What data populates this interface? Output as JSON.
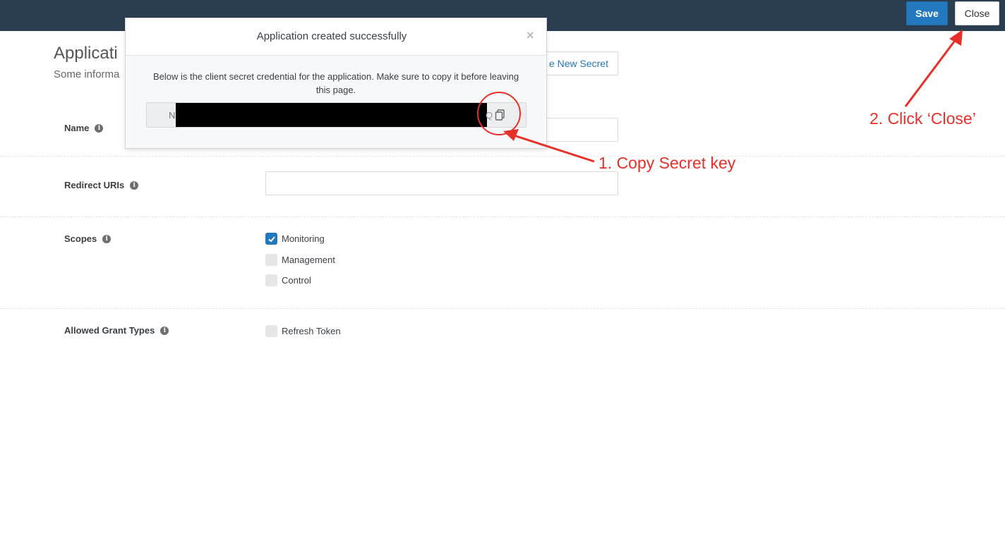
{
  "header": {
    "save_label": "Save",
    "close_label": "Close"
  },
  "page": {
    "title": "Applicati",
    "subtitle": "Some informa",
    "new_secret_label": "e New Secret"
  },
  "form": {
    "name_label": "Name",
    "redirect_label": "Redirect URIs",
    "scopes_label": "Scopes",
    "grant_label": "Allowed Grant Types",
    "scopes": [
      {
        "label": "Monitoring",
        "checked": true
      },
      {
        "label": "Management",
        "checked": false
      },
      {
        "label": "Control",
        "checked": false
      }
    ],
    "grants": [
      {
        "label": "Refresh Token",
        "checked": false
      }
    ]
  },
  "modal": {
    "title": "Application created successfully",
    "close_glyph": "×",
    "body": "Below is the client secret credential for the application. Make sure to copy it before leaving this page.",
    "secret_prefix": "N",
    "secret_suffix": "Q"
  },
  "annotations": {
    "copy": "1. Copy Secret key",
    "close": "2. Click ‘Close’",
    "color": "#e8302a"
  },
  "colors": {
    "topbar": "#2b3e50",
    "primary": "#2379bd"
  }
}
